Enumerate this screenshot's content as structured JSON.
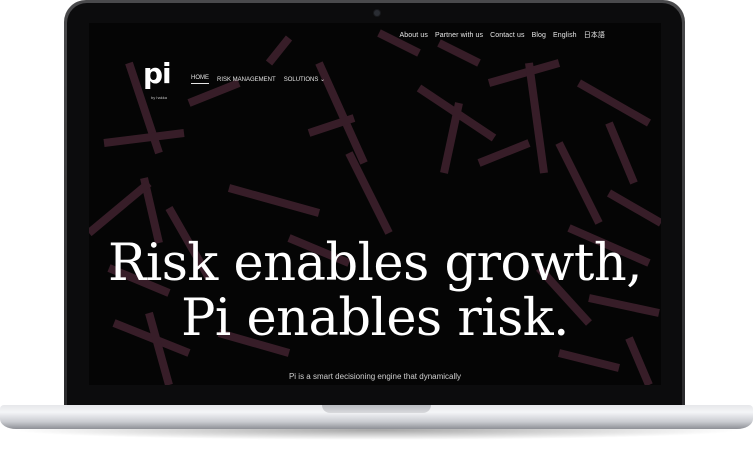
{
  "nav": {
    "top_links": [
      "About us",
      "Partner with us",
      "Contact us",
      "Blog",
      "English",
      "日本語"
    ],
    "main_links": [
      "HOME",
      "RISK MANAGEMENT",
      "SOLUTIONS"
    ],
    "solutions_caret": "⌄"
  },
  "logo": {
    "text": "pi",
    "sub": "by hakka"
  },
  "hero": {
    "line1": "Risk enables growth,",
    "line2": "Pi enables risk.",
    "subtext": "Pi is a smart decisioning engine that dynamically"
  },
  "colors": {
    "screen_bg": "#050505",
    "pattern": "#3a1f2a"
  }
}
